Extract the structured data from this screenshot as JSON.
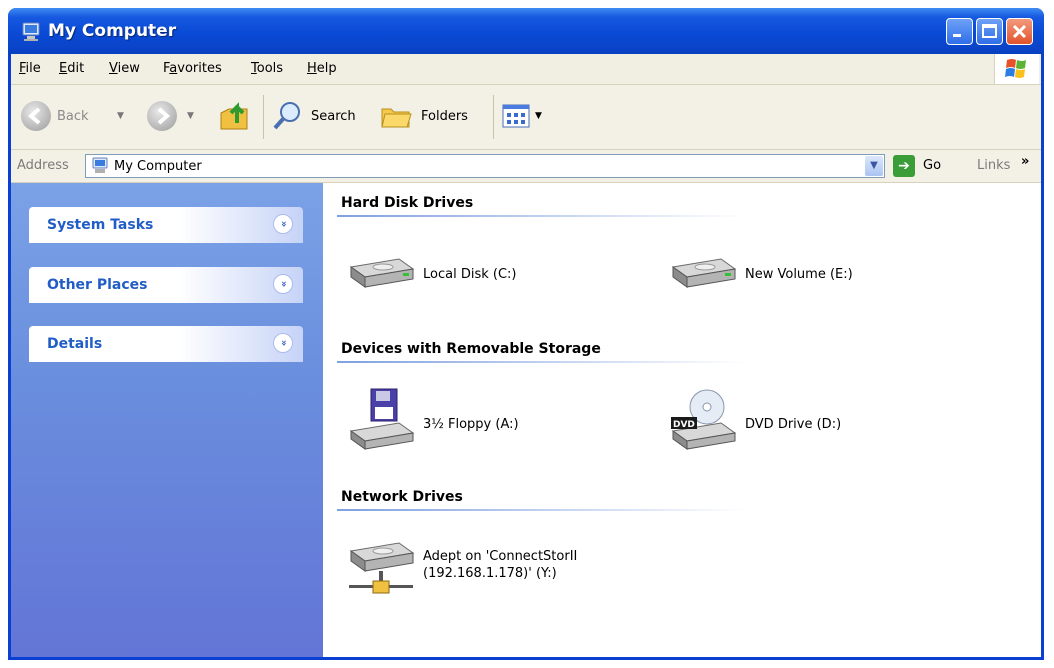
{
  "window": {
    "title": "My Computer",
    "title_icon": "computer-icon",
    "buttons": [
      "minimize-icon",
      "maximize-icon",
      "close-icon"
    ]
  },
  "menu": {
    "items": [
      {
        "pre": "",
        "accel": "F",
        "post": "ile"
      },
      {
        "pre": "",
        "accel": "E",
        "post": "dit"
      },
      {
        "pre": "",
        "accel": "V",
        "post": "iew"
      },
      {
        "pre": "F",
        "accel": "a",
        "post": "vorites"
      },
      {
        "pre": "",
        "accel": "T",
        "post": "ools"
      },
      {
        "pre": "",
        "accel": "H",
        "post": "elp"
      }
    ],
    "logo": "windows-logo-icon"
  },
  "toolbar": {
    "back_label": "Back",
    "search_label": "Search",
    "folders_label": "Folders",
    "icons": [
      "back-icon",
      "forward-icon",
      "up-folder-icon",
      "search-icon",
      "folders-icon",
      "views-icon"
    ]
  },
  "address": {
    "label": "Address",
    "value": "My Computer",
    "go_label": "Go",
    "links_label": "Links",
    "links_chevron": "»"
  },
  "taskpane": {
    "panels": [
      {
        "title": "System Tasks",
        "toggle": "»"
      },
      {
        "title": "Other Places",
        "toggle": "»"
      },
      {
        "title": "Details",
        "toggle": "»"
      }
    ]
  },
  "groups": {
    "hard_disks": {
      "title": "Hard Disk Drives",
      "drives": [
        "Local Disk (C:)",
        "New Volume (E:)"
      ]
    },
    "removable": {
      "title": "Devices with Removable Storage",
      "drives": [
        "3½ Floppy (A:)",
        "DVD Drive (D:)"
      ]
    },
    "network": {
      "title": "Network Drives",
      "drives": [
        {
          "line1": "Adept on 'ConnectStorII",
          "line2": "(192.168.1.178)' (Y:)"
        }
      ]
    }
  },
  "colors": {
    "titlebar": "#0a4ad6",
    "taskpane": "#6a8fde",
    "task_title": "#215dc6"
  }
}
